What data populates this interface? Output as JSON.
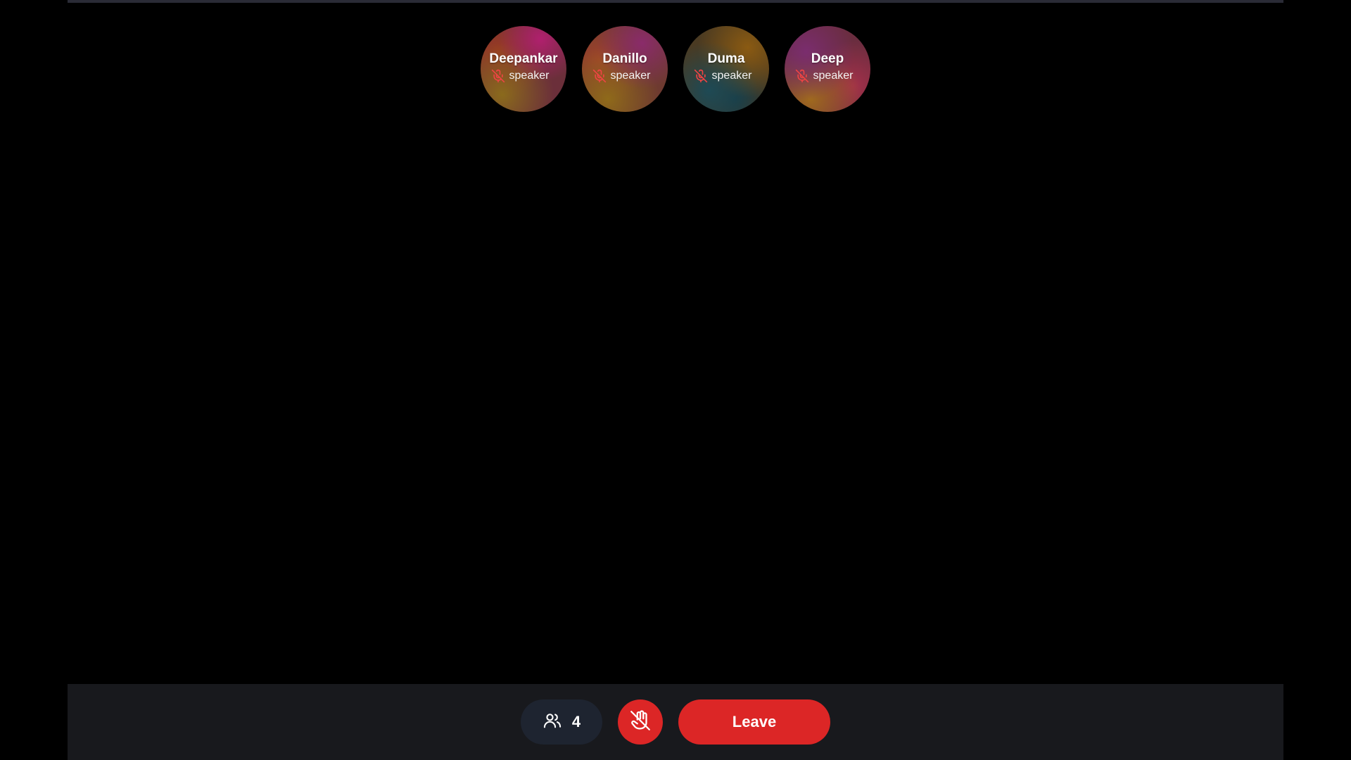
{
  "participants": [
    {
      "name": "Deepankar",
      "role": "speaker",
      "muted": true,
      "icon": "mic-off-icon"
    },
    {
      "name": "Danillo",
      "role": "speaker",
      "muted": true,
      "icon": "mic-off-icon"
    },
    {
      "name": "Duma",
      "role": "speaker",
      "muted": true,
      "icon": "mic-off-icon"
    },
    {
      "name": "Deep",
      "role": "speaker",
      "muted": true,
      "icon": "mic-off-icon"
    }
  ],
  "controls": {
    "participants_count": "4",
    "participants_icon": "users-icon",
    "raise_hand_icon": "hand-off-icon",
    "leave_label": "Leave"
  },
  "colors": {
    "background": "#000000",
    "control_bar": "#18191d",
    "danger": "#dc2626",
    "pill": "#1e2430",
    "mic_off": "#ef4444"
  }
}
